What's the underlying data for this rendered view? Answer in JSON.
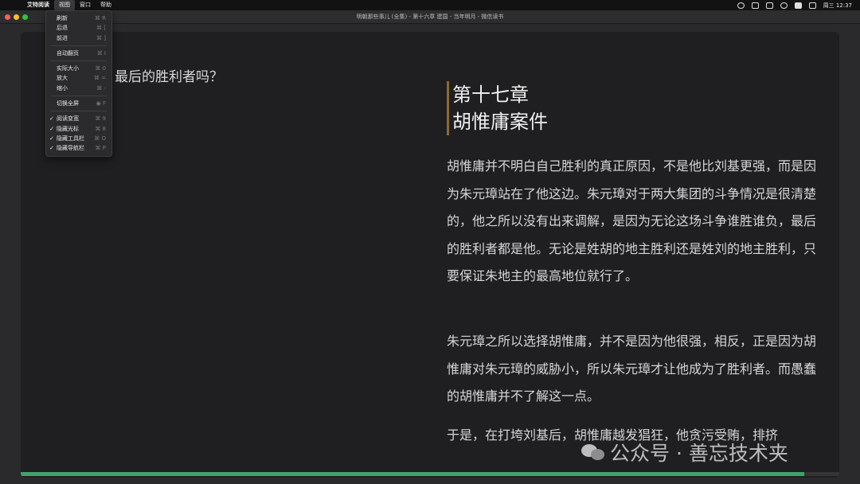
{
  "menubar": {
    "apple": "",
    "items": [
      "艾特阅读",
      "视图",
      "窗口",
      "帮助"
    ],
    "clock": "周三 12:37"
  },
  "window": {
    "title": "明朝那些事儿 (全集) - 第十六章 建国 - 当年明月 - 微信读书"
  },
  "view_menu": {
    "items": [
      {
        "label": "刷新",
        "shortcut": "⌘ R",
        "checked": false
      },
      {
        "label": "后退",
        "shortcut": "⌘ [",
        "checked": false
      },
      {
        "label": "前进",
        "shortcut": "⌘ ]",
        "checked": false
      },
      {
        "separator": true
      },
      {
        "label": "自动翻页",
        "shortcut": "⌘ I",
        "checked": false
      },
      {
        "separator": true
      },
      {
        "label": "实际大小",
        "shortcut": "⌘ 0",
        "checked": false
      },
      {
        "label": "放大",
        "shortcut": "⌘ =",
        "checked": false
      },
      {
        "label": "缩小",
        "shortcut": "⌘ -",
        "checked": false
      },
      {
        "separator": true
      },
      {
        "label": "切换全屏",
        "shortcut": "◉ F",
        "checked": false
      },
      {
        "separator": true
      },
      {
        "label": "阅读变宽",
        "shortcut": "⌘ 9",
        "checked": true
      },
      {
        "label": "隐藏光标",
        "shortcut": "⌘ 8",
        "checked": true
      },
      {
        "label": "隐藏工具栏",
        "shortcut": "⌘ O",
        "checked": true
      },
      {
        "label": "隐藏导航栏",
        "shortcut": "⌘ P",
        "checked": true
      }
    ]
  },
  "reader": {
    "left_fragment": "最后的胜利者吗？",
    "chapter_number": "第十七章",
    "chapter_title": "胡惟庸案件",
    "paragraphs": [
      "胡惟庸并不明白自己胜利的真正原因，不是他比刘基更强，而是因为朱元璋站在了他这边。朱元璋对于两大集团的斗争情况是很清楚的，他之所以没有出来调解，是因为无论这场斗争谁胜谁负，最后的胜利者都是他。无论是姓胡的地主胜利还是姓刘的地主胜利，只要保证朱地主的最高地位就行了。",
      "朱元璋之所以选择胡惟庸，并不是因为他很强，相反，正是因为胡惟庸对朱元璋的威胁小，所以朱元璋才让他成为了胜利者。而愚蠢的胡惟庸并不了解这一点。",
      "于是，在打垮刘基后，胡惟庸越发猖狂，他贪污受贿，排挤"
    ],
    "progress": 0.957
  },
  "watermark": {
    "text": "公众号 · 善忘技术夹"
  },
  "colors": {
    "progress": "#3fa36b",
    "chapter_bar": "#8a6a30",
    "background": "#1f1f21"
  }
}
